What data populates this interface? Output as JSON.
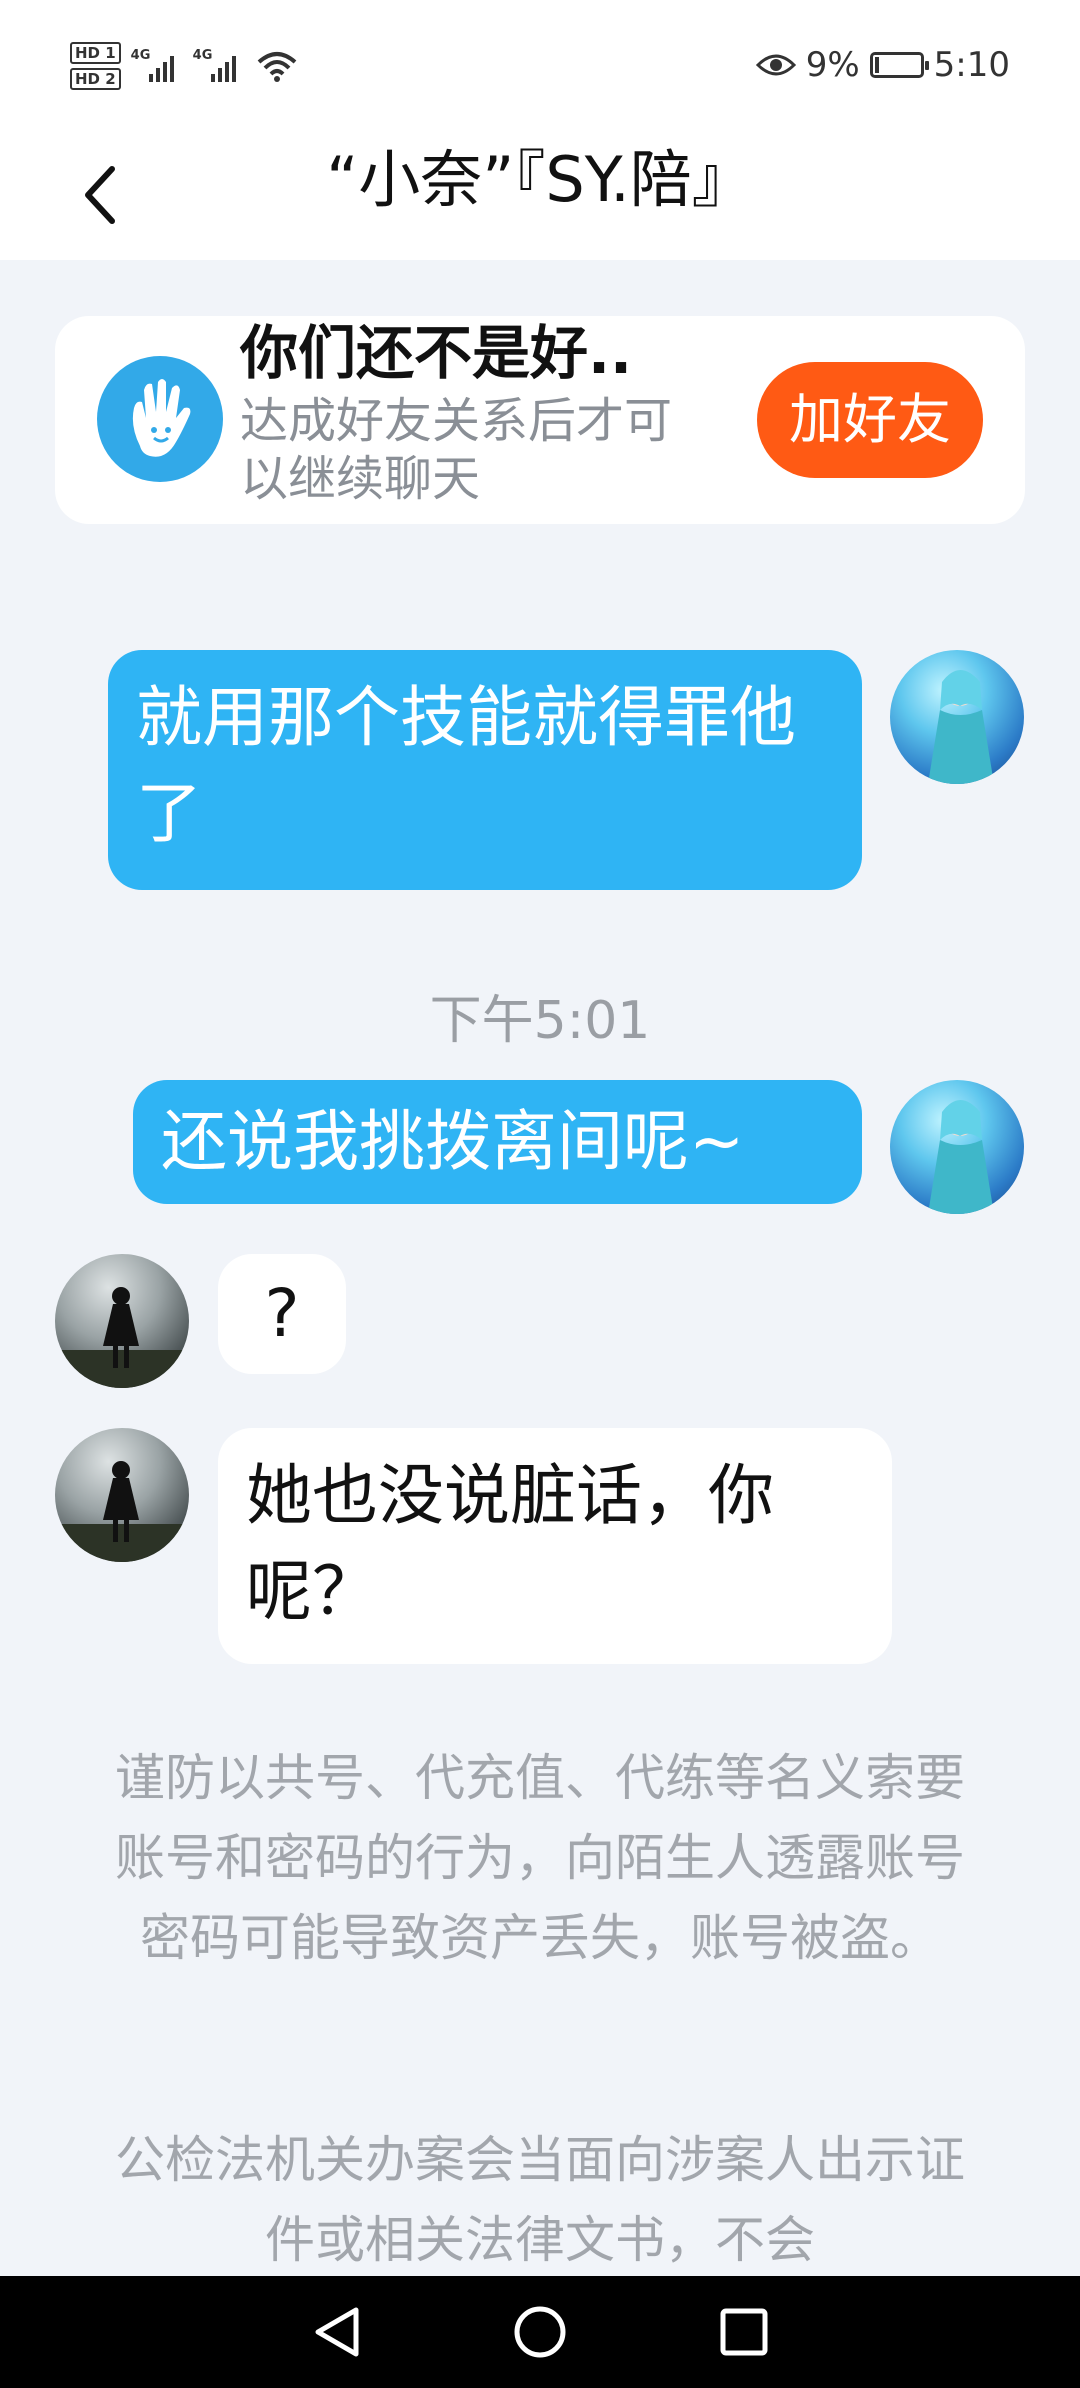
{
  "status_bar": {
    "hd1": "HD 1",
    "hd2": "HD 2",
    "signal1_label": "4G",
    "signal2_label": "4G",
    "battery_percent": "9%",
    "battery_level": 0.09,
    "time": "5:10",
    "icons": [
      "hd-icon",
      "signal-icon",
      "signal-icon",
      "wifi-icon",
      "eye-icon",
      "battery-icon"
    ]
  },
  "header": {
    "title": "“小奈”『SY.陪』",
    "back_icon": "chevron-left-icon"
  },
  "friend_banner": {
    "title": "你们还不是好..",
    "subtitle": "达成好友关系后才可以继续聊天",
    "button": "加好友",
    "icon": "hand-wave-icon"
  },
  "messages": [
    {
      "side": "out",
      "text": "就用那个技能就得罪他了"
    },
    {
      "side": "out",
      "text": "还说我挑拨离间呢~"
    },
    {
      "side": "in",
      "text": "?"
    },
    {
      "side": "in",
      "text": "她也没说脏话，你呢？"
    }
  ],
  "timestamp": "下午5:01",
  "notices": [
    "谨防以共号、代充值、代练等名义索要账号和密码的行为，向陌生人透露账号密码可能导致资产丢失，账号被盗。",
    "公检法机关办案会当面向涉案人出示证件或相关法律文书，不会"
  ],
  "colors": {
    "outgoing_bubble": "#2fb4f4",
    "add_button": "#ff5a14",
    "hand_icon_bg": "#32a9e8",
    "background": "#f1f4f9"
  },
  "nav": {
    "back": "triangle-back-icon",
    "home": "circle-home-icon",
    "recent": "square-recent-icon"
  }
}
